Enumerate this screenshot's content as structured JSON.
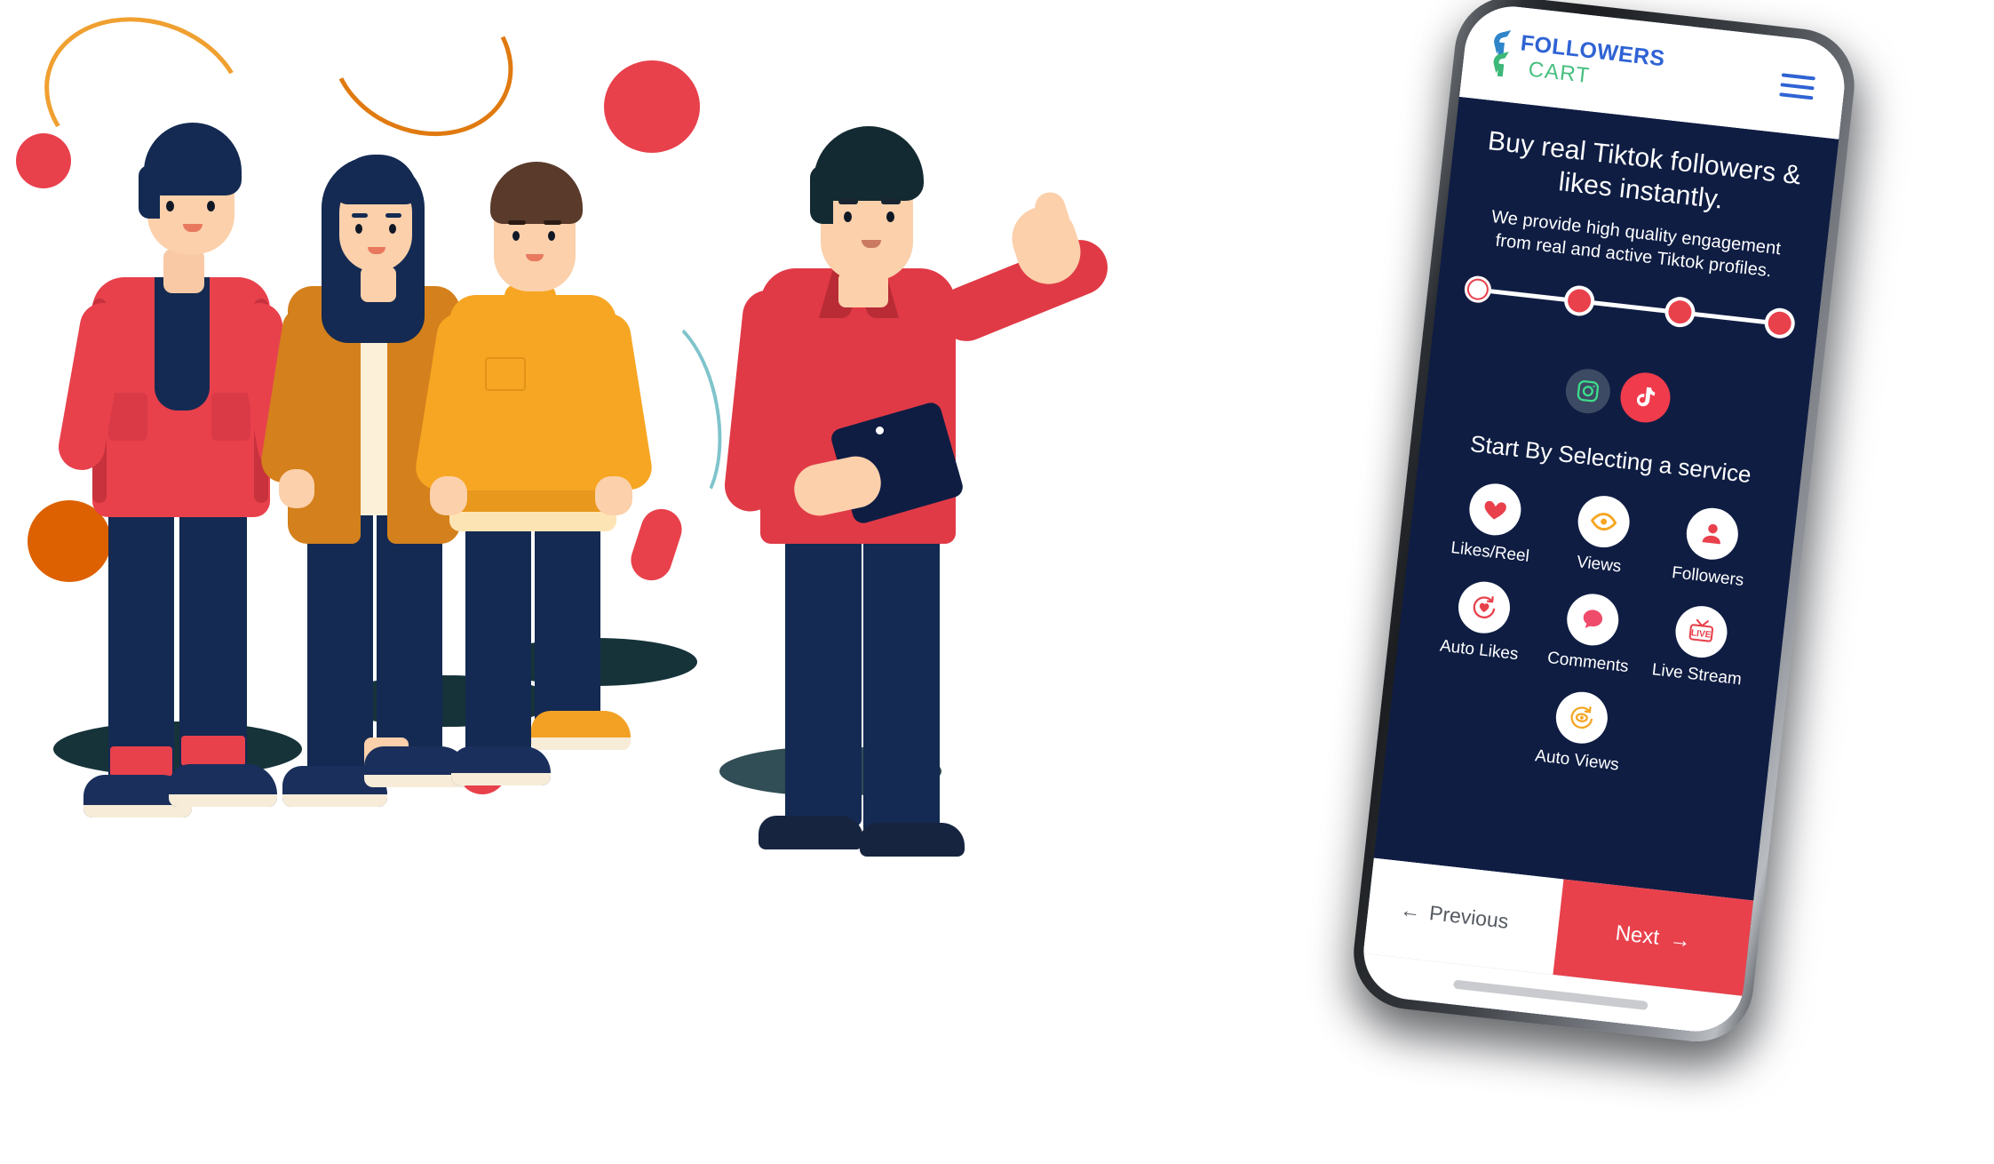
{
  "app": {
    "brand": {
      "line1": "FOLLOWERS",
      "line2": "CART",
      "logo_icon": "followers-cart-logo-icon"
    },
    "menu_icon": "hamburger-menu-icon",
    "headline": "Buy real Tiktok followers & likes instantly.",
    "subhead": "We provide high quality engagement from real and active Tiktok profiles.",
    "stepper": {
      "steps": [
        {
          "index": 1,
          "state": "active"
        },
        {
          "index": 2,
          "state": "pending"
        },
        {
          "index": 3,
          "state": "pending"
        },
        {
          "index": 4,
          "state": "pending"
        }
      ],
      "active_index": 1,
      "total": 4
    },
    "platforms": [
      {
        "name": "Instagram",
        "icon": "instagram-icon",
        "selected": false
      },
      {
        "name": "Tiktok",
        "icon": "tiktok-icon",
        "selected": true
      }
    ],
    "section_title": "Start By Selecting a service",
    "services": [
      {
        "label": "Likes/Reel",
        "icon": "heart-icon",
        "color": "#e8414c"
      },
      {
        "label": "Views",
        "icon": "eye-icon",
        "color": "#f5a623"
      },
      {
        "label": "Followers",
        "icon": "user-icon",
        "color": "#e8414c"
      },
      {
        "label": "Auto Likes",
        "icon": "auto-heart-icon",
        "color": "#e8414c"
      },
      {
        "label": "Comments",
        "icon": "comment-icon",
        "color": "#ef4b6b"
      },
      {
        "label": "Live Stream",
        "icon": "live-tv-icon",
        "color": "#e8414c"
      },
      {
        "label": "Auto Views",
        "icon": "auto-eye-icon",
        "color": "#f5a623"
      }
    ],
    "footer": {
      "previous_label": "Previous",
      "previous_icon": "arrow-left-icon",
      "next_label": "Next",
      "next_icon": "arrow-right-icon"
    }
  },
  "theme": {
    "navy": "#0f1d43",
    "red": "#e8414c",
    "white": "#ffffff",
    "brand_blue": "#2f63d4",
    "brand_green": "#46bf7e",
    "amber": "#f5a623",
    "pink": "#ef4b6b"
  },
  "illustration": {
    "characters": [
      {
        "name": "person-red-jacket"
      },
      {
        "name": "person-mustard-cardigan"
      },
      {
        "name": "person-orange-sweater"
      },
      {
        "name": "person-presenter-pointing"
      }
    ],
    "decorations": [
      {
        "name": "red-circle-small"
      },
      {
        "name": "red-circle-large"
      },
      {
        "name": "orange-circle"
      },
      {
        "name": "red-pill"
      },
      {
        "name": "red-circle-bottom"
      },
      {
        "name": "orange-arc-top-left"
      },
      {
        "name": "orange-arc-top-mid"
      },
      {
        "name": "teal-arc"
      }
    ]
  }
}
